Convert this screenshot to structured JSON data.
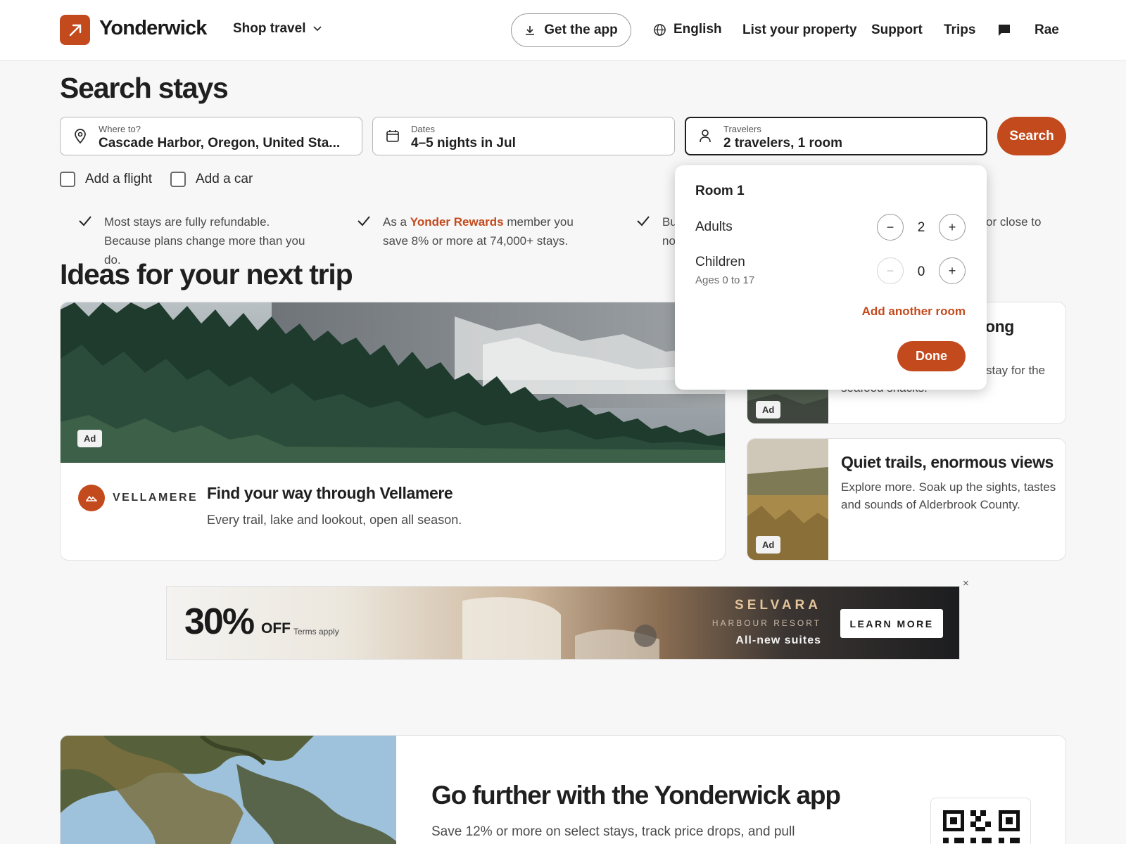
{
  "header": {
    "brand": "Yonderwick",
    "shop_travel": "Shop travel",
    "get_app": "Get the app",
    "language": "English",
    "list_property": "List your property",
    "support": "Support",
    "trips": "Trips",
    "user": "Rae"
  },
  "search": {
    "title": "Search stays",
    "where_label": "Where to?",
    "where_value": "Cascade Harbor, Oregon, United Sta...",
    "dates_label": "Dates",
    "dates_value": "4–5 nights in Jul",
    "travelers_label": "Travelers",
    "travelers_value": "2 travelers, 1 room",
    "search_button": "Search",
    "add_flight": "Add a flight",
    "add_car": "Add a car"
  },
  "benefits": [
    {
      "text": "Most stays are fully refundable. Because plans change more than you do."
    },
    {
      "pre": "As a ",
      "accent": "Yonder Rewards",
      "post": " member you save 8% or more at 74,000+ stays."
    },
    {
      "line1_start": "Bu",
      "line1_end": "or close to",
      "line2_start": "no"
    }
  ],
  "ideas": {
    "title": "Ideas for your next trip",
    "big_card": {
      "ad": "Ad",
      "brand": "VELLAMERE",
      "title": "Find your way through Vellamere",
      "subtitle": "Every trail, lake and lookout, open all season."
    },
    "side_card_1": {
      "ad": "Ad",
      "title_visible": "ong",
      "sub_line1_visible": "stay for the",
      "sub_line2_visible": "seafood snacks."
    },
    "side_card_2": {
      "ad": "Ad",
      "title": "Quiet trails, enormous views",
      "subtitle": "Explore more. Soak up the sights, tastes and sounds of Alderbrook County."
    }
  },
  "travelers_popover": {
    "room_title": "Room 1",
    "adults_label": "Adults",
    "adults_value": "2",
    "children_label": "Children",
    "children_sub": "Ages 0 to 17",
    "children_value": "0",
    "minus": "−",
    "plus": "+",
    "add_room": "Add another room",
    "done": "Done"
  },
  "banner": {
    "percent": "30%",
    "off": "OFF",
    "terms": "Terms apply",
    "resort_name": "SELVARA",
    "resort_sub": "HARBOUR RESORT",
    "tagline": "All-new suites",
    "cta": "LEARN MORE",
    "close": "×"
  },
  "app_promo": {
    "title": "Go further with the Yonderwick app",
    "subtitle": "Save 12% or more on select stays, track price drops, and pull"
  },
  "colors": {
    "accent": "#c34a1d",
    "text": "#1f1f1f",
    "background": "#f7f7f7"
  }
}
